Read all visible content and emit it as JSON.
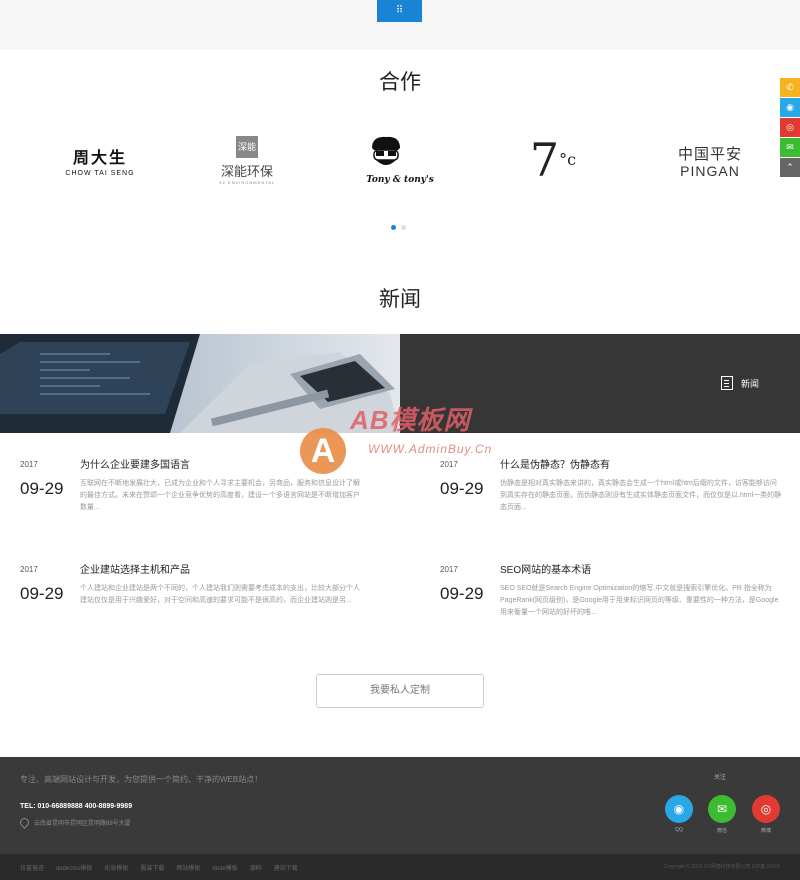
{
  "top": {
    "button_icon": "grid-icon",
    "button_glyph": "⠿"
  },
  "partners": {
    "title": "合作",
    "logos": [
      {
        "name": "chow-tai-seng",
        "main": "周大生",
        "sub": "CHOW TAI SENG"
      },
      {
        "name": "shenneng",
        "box": "深能",
        "main": "深能环保",
        "sub": "SZ ENVIRONMENTAL"
      },
      {
        "name": "tony-and-tonys",
        "main": "Tony & tony's"
      },
      {
        "name": "7c",
        "main": "7",
        "sup": "°c"
      },
      {
        "name": "pingan",
        "main": "中国平安",
        "sub": "PINGAN"
      }
    ],
    "active_dot": 1
  },
  "news": {
    "title": "新闻",
    "banner_link": "新闻",
    "items": [
      {
        "year": "2017",
        "day": "09-29",
        "title": "为什么企业要建多国语言",
        "desc": "互联网在不断地发展壮大，已成为企业和个人寻求主要机会，另商品，服务和信息设计了解的最佳方式。未来在赞颂一个企业竞争优势的高度看，建设一个多语言网站是不断增加客户数量..."
      },
      {
        "year": "2017",
        "day": "09-29",
        "title": "什么是伪静态？伪静态有",
        "desc": "伪静态是相对真实静态来讲的，真实静态会生成一个html或htm后缀的文件，访客能够访问到真实存在的静态页面，而伪静态则没有生成实体静态页面文件，而仅仅是以.html一类的静态页面..."
      },
      {
        "year": "2017",
        "day": "09-29",
        "title": "企业建站选择主机和产品",
        "desc": "个人建站和企业建站是两个不同的，个人建站我们则需要考虑成本的支出，比较大部分个人建站仅仅是用于兴趣爱好，对于空间和高速的要求可能不是很高的，而企业建站则是另..."
      },
      {
        "year": "2017",
        "day": "09-29",
        "title": "SEO网站的基本术语",
        "desc": "SEO SEO就是Search Engine Optimization的缩写,中文就是搜索引擎优化。PR 指全称为PageRank(网页级别)，是Google用于用来标识网页的等级、重要性的一种方法，是Google用来衡量一个网站的好坏的唯..."
      }
    ]
  },
  "watermark": {
    "logo_letter": "A",
    "title": "AB模板网",
    "url": "WWW.AdminBuy.Cn"
  },
  "custom_button": "我要私人定制",
  "footer": {
    "slogan": "专注、高端网站设计与开发，为您提供一个简约、干净的WEB站点！",
    "tel": "TEL: 010-66889888 400-8899-9989",
    "address": "云南省昆明市昆明区昆明路88号大厦",
    "follow": "关注",
    "social": [
      {
        "name": "qq",
        "glyph": "◉",
        "label": "QQ"
      },
      {
        "name": "wechat",
        "glyph": "✉",
        "label": "微信"
      },
      {
        "name": "weibo",
        "glyph": "◎",
        "label": "微博"
      }
    ],
    "links": [
      "拉盖留迹",
      "dedecms模板",
      "化妆模板",
      "服装下载",
      "网站模板",
      "dede模板",
      "源码",
      "建站下载"
    ],
    "copyright": "Copyright © 2016 XX网络科技有限公司 ICP备 XXXX"
  },
  "side_bar": [
    {
      "name": "phone",
      "glyph": "✆"
    },
    {
      "name": "qq",
      "glyph": "◉"
    },
    {
      "name": "weibo",
      "glyph": "◎"
    },
    {
      "name": "wechat",
      "glyph": "✉"
    },
    {
      "name": "back-to-top",
      "glyph": "⌃"
    }
  ]
}
